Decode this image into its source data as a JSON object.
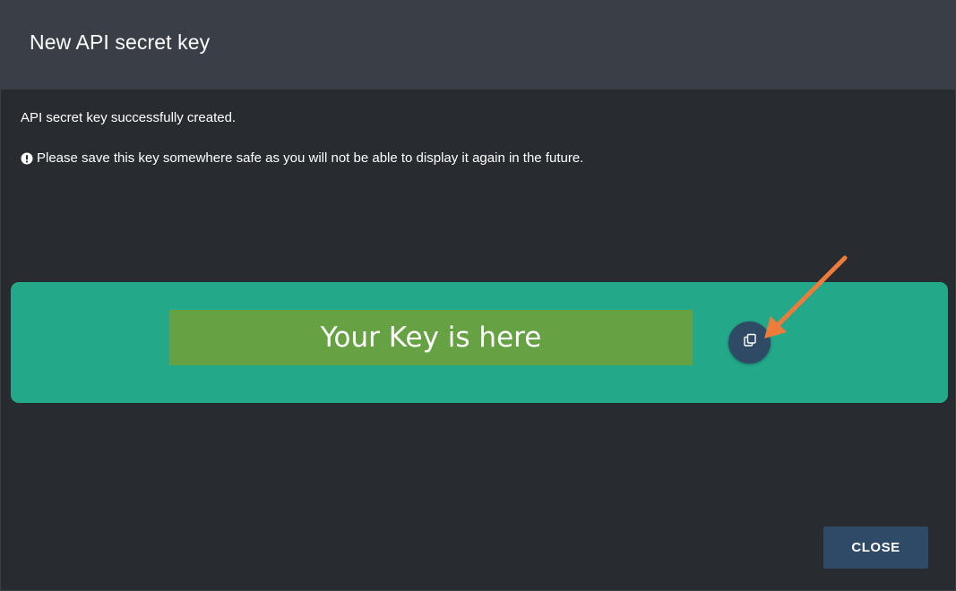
{
  "dialog": {
    "title": "New API secret key",
    "success_message": "API secret key successfully created.",
    "warning_message": "Please save this key somewhere safe as you will not be able to display it again in the future.",
    "key_placeholder": "Your Key is here",
    "close_label": "CLOSE"
  },
  "icons": {
    "warning": "exclamation-circle-icon",
    "copy": "copy-icon"
  },
  "colors": {
    "background": "#282c31",
    "header": "#3a3f47",
    "key_panel": "#23a88a",
    "key_box": "#66a144",
    "button": "#2f4a66",
    "annotation_arrow": "#f07c3c"
  }
}
